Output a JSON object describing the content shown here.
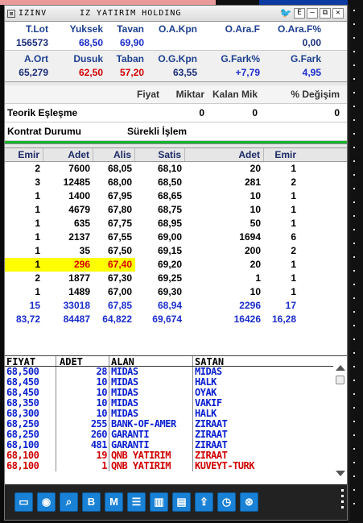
{
  "window": {
    "symbol": "IZINV",
    "company": "IZ YATIRIM HOLDING",
    "buttons": [
      "E",
      "–",
      "⧉",
      "✕"
    ]
  },
  "summary_row1": {
    "labels": [
      "T.Lot",
      "Yuksek",
      "Tavan",
      "O.A.Kpn",
      "O.Ara.F",
      "O.Ara.F%"
    ],
    "values": [
      "156573",
      "68,50",
      "69,90",
      "",
      "",
      "0,00"
    ]
  },
  "summary_row2": {
    "labels": [
      "A.Ort",
      "Dusuk",
      "Taban",
      "O.G.Kpn",
      "G.Fark%",
      "G.Fark"
    ],
    "values": [
      "65,279",
      "62,50",
      "57,20",
      "63,55",
      "+7,79",
      "4,95"
    ]
  },
  "match": {
    "headers": [
      "Fiyat",
      "Miktar",
      "Kalan Mik",
      "% Değişim"
    ],
    "teorik_label": "Teorik Eşleşme",
    "teorik_values": [
      "",
      "0",
      "0",
      "0"
    ],
    "kontrat_label": "Kontrat Durumu",
    "kontrat_value": "Sürekli İşlem"
  },
  "orderbook": {
    "headers": [
      "Emir",
      "Adet",
      "Alis",
      "Satis",
      "Adet",
      "Emir"
    ],
    "rows": [
      [
        "2",
        "7600",
        "68,05",
        "68,10",
        "20",
        "1"
      ],
      [
        "3",
        "12485",
        "68,00",
        "68,50",
        "281",
        "2"
      ],
      [
        "1",
        "1400",
        "67,95",
        "68,65",
        "10",
        "1"
      ],
      [
        "1",
        "4679",
        "67,80",
        "68,75",
        "10",
        "1"
      ],
      [
        "1",
        "635",
        "67,75",
        "68,95",
        "50",
        "1"
      ],
      [
        "1",
        "2137",
        "67,55",
        "69,00",
        "1694",
        "6"
      ],
      [
        "1",
        "35",
        "67,50",
        "69,15",
        "200",
        "2"
      ],
      [
        "1",
        "296",
        "67,40",
        "69,20",
        "20",
        "1"
      ],
      [
        "2",
        "1877",
        "67,30",
        "69,25",
        "1",
        "1"
      ],
      [
        "1",
        "1489",
        "67,00",
        "69,30",
        "10",
        "1"
      ]
    ],
    "total": [
      "15",
      "33018",
      "67,85",
      "68,94",
      "2296",
      "17"
    ],
    "average": [
      "83,72",
      "84487",
      "64,822",
      "69,674",
      "16426",
      "16,28"
    ]
  },
  "trades": {
    "headers": [
      "FIYAT",
      "ADET",
      "ALAN",
      "SATAN"
    ],
    "rows": [
      {
        "fiyat": "68,500",
        "adet": "28",
        "alan": "MIDAS",
        "satan": "MIDAS",
        "side": "buy"
      },
      {
        "fiyat": "68,450",
        "adet": "10",
        "alan": "MIDAS",
        "satan": "HALK",
        "side": "buy"
      },
      {
        "fiyat": "68,450",
        "adet": "10",
        "alan": "MIDAS",
        "satan": "OYAK",
        "side": "buy"
      },
      {
        "fiyat": "68,350",
        "adet": "10",
        "alan": "MIDAS",
        "satan": "VAKIF",
        "side": "buy"
      },
      {
        "fiyat": "68,300",
        "adet": "10",
        "alan": "MIDAS",
        "satan": "HALK",
        "side": "buy"
      },
      {
        "fiyat": "68,250",
        "adet": "255",
        "alan": "BANK-OF-AMER",
        "satan": "ZIRAAT",
        "side": "buy"
      },
      {
        "fiyat": "68,250",
        "adet": "260",
        "alan": "GARANTI",
        "satan": "ZIRAAT",
        "side": "buy"
      },
      {
        "fiyat": "68,100",
        "adet": "481",
        "alan": "GARANTI",
        "satan": "ZIRAAT",
        "side": "buy"
      },
      {
        "fiyat": "68,100",
        "adet": "19",
        "alan": "QNB YATIRIM",
        "satan": "ZIRAAT",
        "side": "sell"
      },
      {
        "fiyat": "68,100",
        "adet": "1",
        "alan": "QNB YATIRIM",
        "satan": "KUVEYT-TURK",
        "side": "sell"
      }
    ]
  },
  "toolbar": {
    "icons": [
      "monitor-icon",
      "globe-icon",
      "search-chart-icon",
      "bold-b-icon",
      "m-logo-icon",
      "list-icon",
      "bar-chart-icon",
      "news-icon",
      "share-icon",
      "clock-icon",
      "settings-icon"
    ],
    "glyphs": [
      "▭",
      "◉",
      "⌕",
      "B",
      "M",
      "☰",
      "▥",
      "▤",
      "⇪",
      "◷",
      "⊛"
    ]
  },
  "colors": {
    "header_blue": "#1c3f8f",
    "positive": "#1a2ccc",
    "negative": "#d40000",
    "highlight": "#ffff00",
    "status_green": "#18b42e",
    "toolbar_button": "#1a82d6"
  }
}
